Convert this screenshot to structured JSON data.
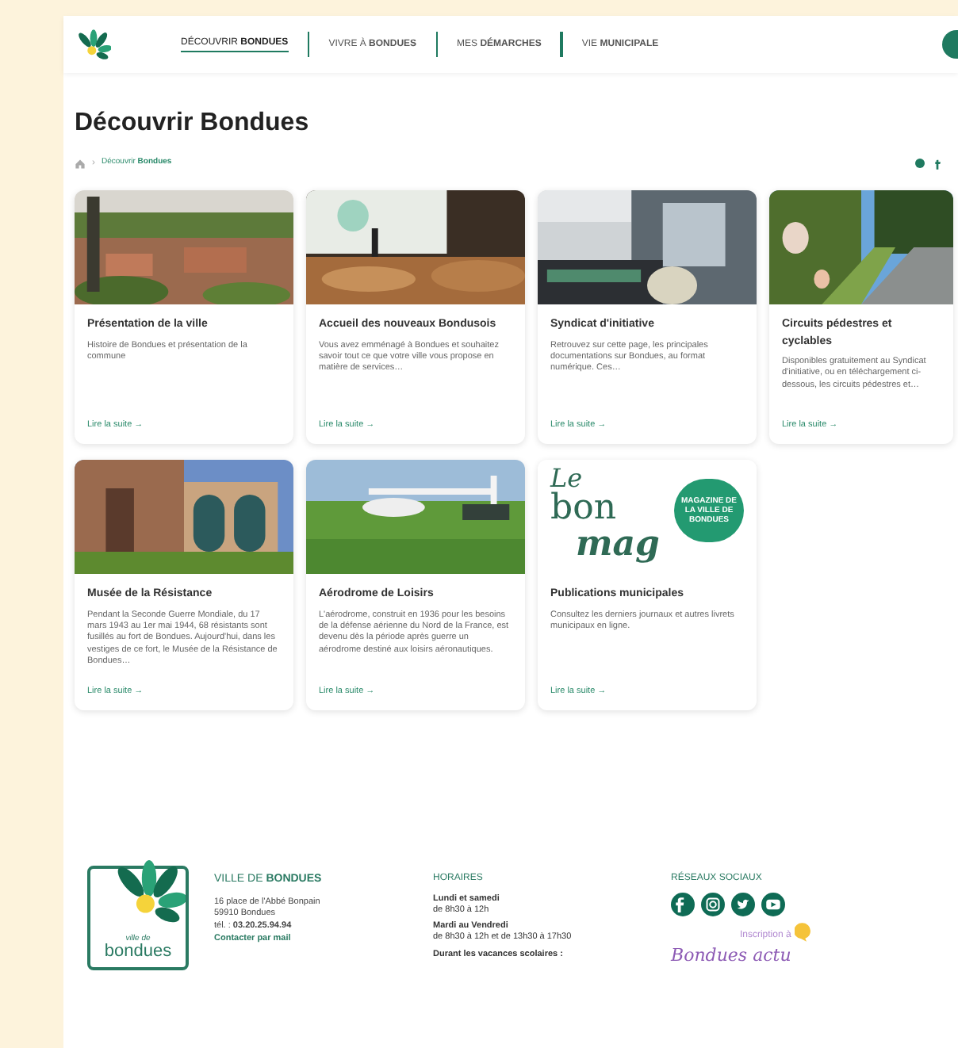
{
  "header": {
    "nav": [
      {
        "label": "DÉCOUVRIR **BONDUES**",
        "selected": true
      },
      {
        "label": "VIVRE À **BONDUES**",
        "selected": false
      },
      {
        "label": "MES **DÉMARCHES**",
        "selected": false
      },
      {
        "label": "VIE **MUNICIPALE**",
        "selected": false
      }
    ]
  },
  "page_title": "Découvrir Bondues",
  "breadcrumb": {
    "separator": "›",
    "current": "Découvrir **Bondues**"
  },
  "cards": [
    {
      "kind": "picture",
      "title": "Présentation de la ville",
      "text": "Histoire de Bondues et présentation de la commune",
      "link": "Lire la suite →"
    },
    {
      "kind": "picture",
      "title": "Accueil des nouveaux Bondusois",
      "text": "Vous avez emménagé à Bondues et souhaitez savoir tout ce que votre ville vous propose en matière de services…",
      "link": "Lire la suite →"
    },
    {
      "kind": "picture",
      "title": "Syndicat d'initiative",
      "text": "Retrouvez sur cette page, les principales documentations sur Bondues, au format numérique. Ces…",
      "link": "Lire la suite →"
    },
    {
      "kind": "picture",
      "title": "Circuits pédestres et cyclables",
      "text": "Disponibles gratuitement au Syndicat d'initiative, ou en téléchargement ci-dessous, les circuits pédestres et…",
      "link": "Lire la suite →"
    },
    {
      "kind": "picture",
      "title": "Musée de la Résistance",
      "text": "Pendant la Seconde Guerre Mondiale, du 17 mars 1943 au 1er mai 1944, 68 résistants sont fusillés au fort de Bondues. Aujourd'hui, dans les vestiges de ce fort, le Musée de la Résistance de Bondues…",
      "link": "Lire la suite →"
    },
    {
      "kind": "picture",
      "title": "Aérodrome de Loisirs",
      "text": "L'aérodrome, construit en 1936 pour les besoins de la défense aérienne du Nord de la France, est devenu dès la période après guerre un aérodrome destiné aux loisirs aéronautiques.",
      "link": "Lire la suite →"
    },
    {
      "kind": "logo",
      "logo": [
        "Le",
        "bon",
        "mag"
      ],
      "badge": "MAGAZINE DE LA VILLE DE BONDUES",
      "title": "Publications municipales",
      "text": "Consultez les derniers journaux et autres livrets municipaux en ligne.",
      "link": "Lire la suite →"
    }
  ],
  "footer": {
    "logo_text": [
      "ville de",
      "bondues"
    ],
    "contact": {
      "heading": "VILLE DE **BONDUES**",
      "lines": [
        "16 place de l'Abbé Bonpain",
        "59910 Bondues",
        "tél. : **03.20.25.94.94**"
      ],
      "link": "Contacter par mail"
    },
    "hours": {
      "heading": "HORAIRES",
      "entries": [
        {
          "days": "Lundi et samedi",
          "time": "de 8h30 à 12h"
        },
        {
          "days": "Mardi au Vendredi",
          "time": "de 8h30 à 12h et de 13h30 à 17h30"
        },
        {
          "days": "Durant les vacances scolaires :"
        }
      ]
    },
    "social": {
      "heading": "RÉSEAUX SOCIAUX",
      "networks": [
        {
          "kind": "facebook"
        },
        {
          "kind": "instagram"
        },
        {
          "kind": "twitter"
        },
        {
          "kind": "youtube"
        }
      ],
      "signup": "Inscription à",
      "brand": "Bondues actu"
    }
  }
}
